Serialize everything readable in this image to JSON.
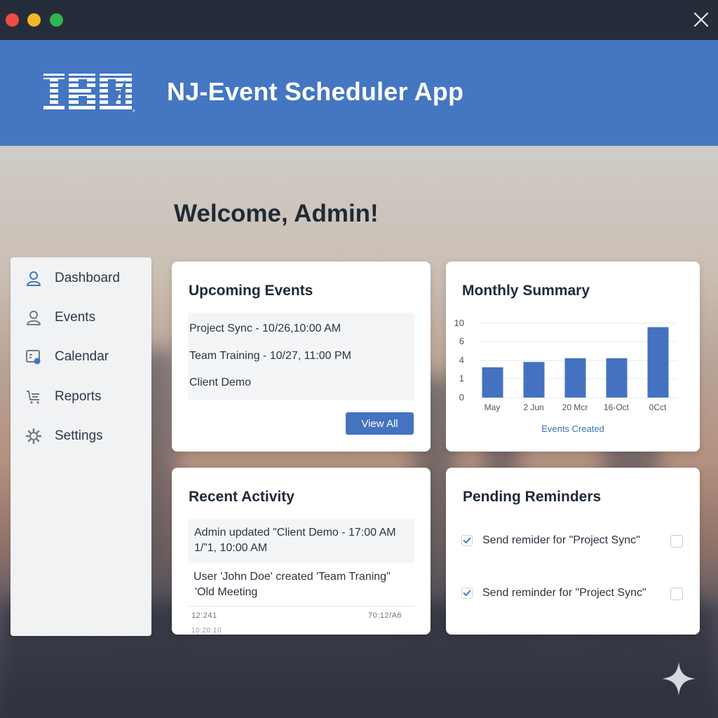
{
  "app": {
    "title": "NJ-Event Scheduler App",
    "logo_text": "IBM"
  },
  "welcome": "Welcome, Admin!",
  "sidebar": {
    "items": [
      {
        "label": "Dashboard",
        "icon": "user-icon"
      },
      {
        "label": "Events",
        "icon": "user-icon"
      },
      {
        "label": "Calendar",
        "icon": "calendar-icon"
      },
      {
        "label": "Reports",
        "icon": "cart-icon"
      },
      {
        "label": "Settings",
        "icon": "gear-icon"
      }
    ]
  },
  "upcoming": {
    "title": "Upcoming Events",
    "events": [
      "Project Sync - 10/26,10:00 AM",
      "Team Training - 10/27, 11:00 PM",
      "Client Demo"
    ],
    "button": "View All"
  },
  "summary": {
    "title": "Monthly Summary"
  },
  "chart_data": {
    "type": "bar",
    "categories": [
      "May",
      "2 Jun",
      "20 Mcr",
      "16-Oct",
      "0Cct"
    ],
    "values": [
      4,
      4.7,
      5.2,
      5.2,
      9.3
    ],
    "xlabel": "Events Created",
    "ylabel": "",
    "yticks": [
      "10",
      "6",
      "4",
      "1",
      "0"
    ],
    "ylim": [
      0,
      10
    ],
    "grid": true
  },
  "activity": {
    "title": "Recent Activity",
    "entries": [
      {
        "line1": "Admin updated \"Client Demo - 17:00 AM",
        "line2": "1/”1, 10:00 AM"
      },
      {
        "line1": "User 'John Doe' created 'Team Traning\"",
        "line2": "'Old Meeting"
      }
    ],
    "time_left": "12:241",
    "time_right": "70:12/A6",
    "time_left2": "10:20:10"
  },
  "reminders": {
    "title": "Pending Reminders",
    "items": [
      {
        "label": "Send remider for \"Project Sync\"",
        "checked": true
      },
      {
        "label": "Send reminder for \"Project Sync\"",
        "checked": true
      }
    ]
  },
  "colors": {
    "header": "#4476c2",
    "accent": "#4473c0",
    "bar": "#4472c0"
  }
}
